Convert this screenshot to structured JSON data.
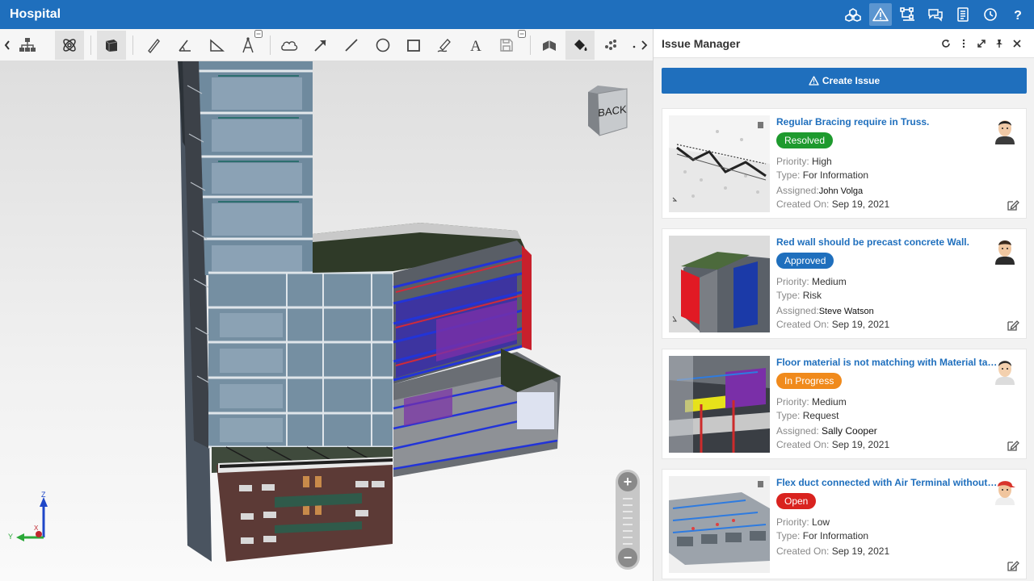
{
  "app": {
    "title": "Hospital"
  },
  "viewport": {
    "navcube_label": "BACK",
    "zoom_in": "+",
    "zoom_out": "−",
    "axes": {
      "z": "Z",
      "y": "Y",
      "x": "X"
    }
  },
  "toolbar": {
    "more_label": "›"
  },
  "panel": {
    "title": "Issue Manager",
    "create_label": "Create Issue",
    "labels": {
      "priority": "Priority:",
      "type": "Type:",
      "assigned": "Assigned:",
      "created": "Created On:"
    },
    "issues": [
      {
        "title": "Regular Bracing require in Truss.",
        "status": "Resolved",
        "status_color": "#1e9a2e",
        "priority": "High",
        "type": "For Information",
        "assigned": "John Volga",
        "created": "Sep 19, 2021"
      },
      {
        "title": "Red wall should be precast concrete Wall.",
        "status": "Approved",
        "status_color": "#1f6fbd",
        "priority": "Medium",
        "type": "Risk",
        "assigned": "Steve Watson",
        "created": "Sep 19, 2021"
      },
      {
        "title": "Floor material is not matching with Material takeoff list.",
        "status": "In Progress",
        "status_color": "#f08a1c",
        "priority": "Medium",
        "type": "Request",
        "assigned": "Sally Cooper",
        "created": "Sep 19, 2021"
      },
      {
        "title": "Flex duct connected with Air Terminal without security ...",
        "status": "Open",
        "status_color": "#d9231f",
        "priority": "Low",
        "type": "For Information",
        "assigned": "",
        "created": "Sep 19, 2021"
      }
    ]
  },
  "colors": {
    "brand": "#1f6fbd",
    "panel_bg": "#f2f2f2"
  }
}
